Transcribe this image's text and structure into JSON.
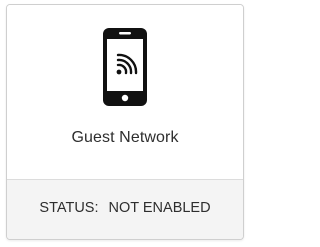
{
  "card": {
    "icon": "mobile-wifi-icon",
    "title": "Guest Network",
    "status_label": "STATUS:",
    "status_value": "NOT ENABLED"
  },
  "colors": {
    "icon": "#111111",
    "border": "#cfcfcf",
    "footer_bg": "#f4f4f4",
    "text": "#2e2e2e"
  }
}
